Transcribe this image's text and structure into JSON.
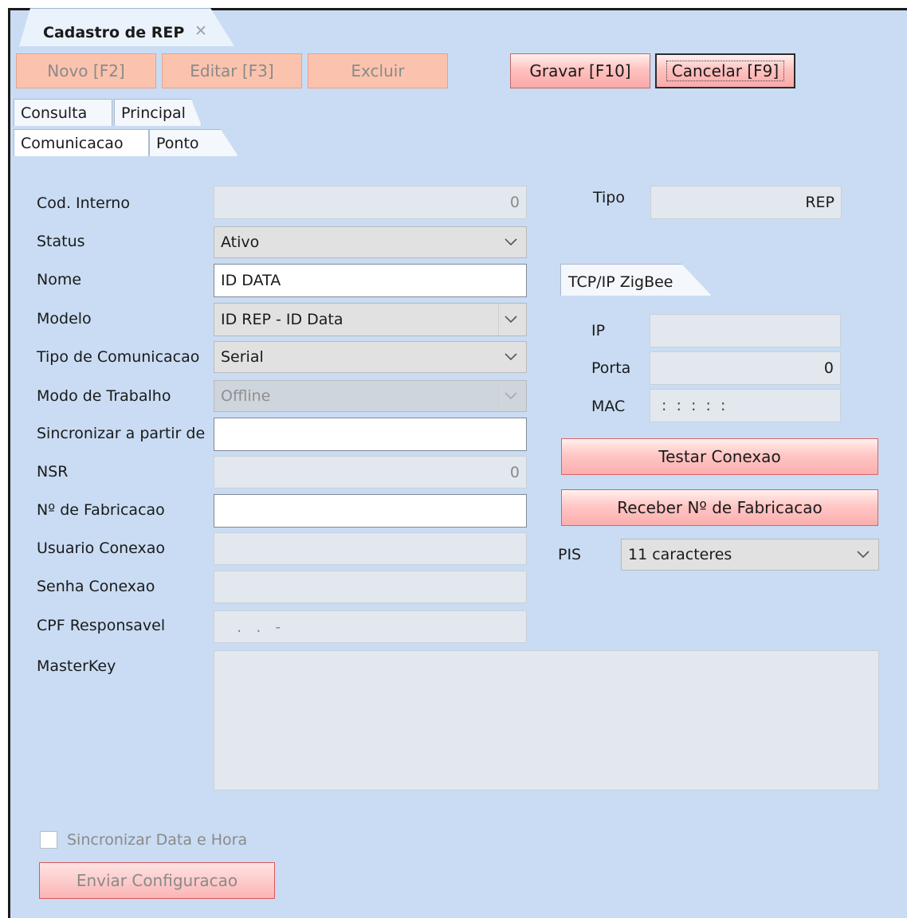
{
  "document_tab": {
    "label": "Cadastro de REP",
    "close": "✕"
  },
  "toolbar": {
    "novo": "Novo [F2]",
    "editar": "Editar [F3]",
    "excluir": "Excluir",
    "gravar": "Gravar [F10]",
    "cancelar": "Cancelar [F9]"
  },
  "tabs_row1": [
    "Consulta",
    "Principal"
  ],
  "tabs_row2": [
    "Comunicacao",
    "Ponto"
  ],
  "form": {
    "cod_interno": {
      "label": "Cod. Interno",
      "value": "0"
    },
    "status": {
      "label": "Status",
      "value": "Ativo"
    },
    "nome": {
      "label": "Nome",
      "value": "ID DATA"
    },
    "modelo": {
      "label": "Modelo",
      "value": "ID REP - ID Data"
    },
    "tipo_comunicacao": {
      "label": "Tipo de Comunicacao",
      "value": "Serial"
    },
    "modo_trabalho": {
      "label": "Modo de Trabalho",
      "value": "Offline"
    },
    "sincronizar": {
      "label": "Sincronizar a partir de",
      "value": ""
    },
    "nsr": {
      "label": "NSR",
      "value": "0"
    },
    "n_fabricacao": {
      "label": "Nº de Fabricacao",
      "value": ""
    },
    "usuario_conexao": {
      "label": "Usuario Conexao",
      "value": ""
    },
    "senha_conexao": {
      "label": "Senha Conexao",
      "value": ""
    },
    "cpf_responsavel": {
      "label": "CPF Responsavel",
      "value": " .   .   -"
    },
    "masterkey": {
      "label": "MasterKey",
      "value": ""
    }
  },
  "right": {
    "tipo": {
      "label": "Tipo",
      "value": "REP"
    },
    "conn_tab": "TCP/IP ZigBee",
    "ip": {
      "label": "IP",
      "value": ""
    },
    "porta": {
      "label": "Porta",
      "value": "0"
    },
    "mac": {
      "label": "MAC",
      "value": " :  :  :  :  :"
    },
    "testar": "Testar Conexao",
    "receber": "Receber Nº de Fabricacao",
    "pis": {
      "label": "PIS",
      "value": "11 caracteres"
    }
  },
  "footer": {
    "sync_checkbox": "Sincronizar Data e Hora",
    "enviar": "Enviar Configuracao"
  }
}
